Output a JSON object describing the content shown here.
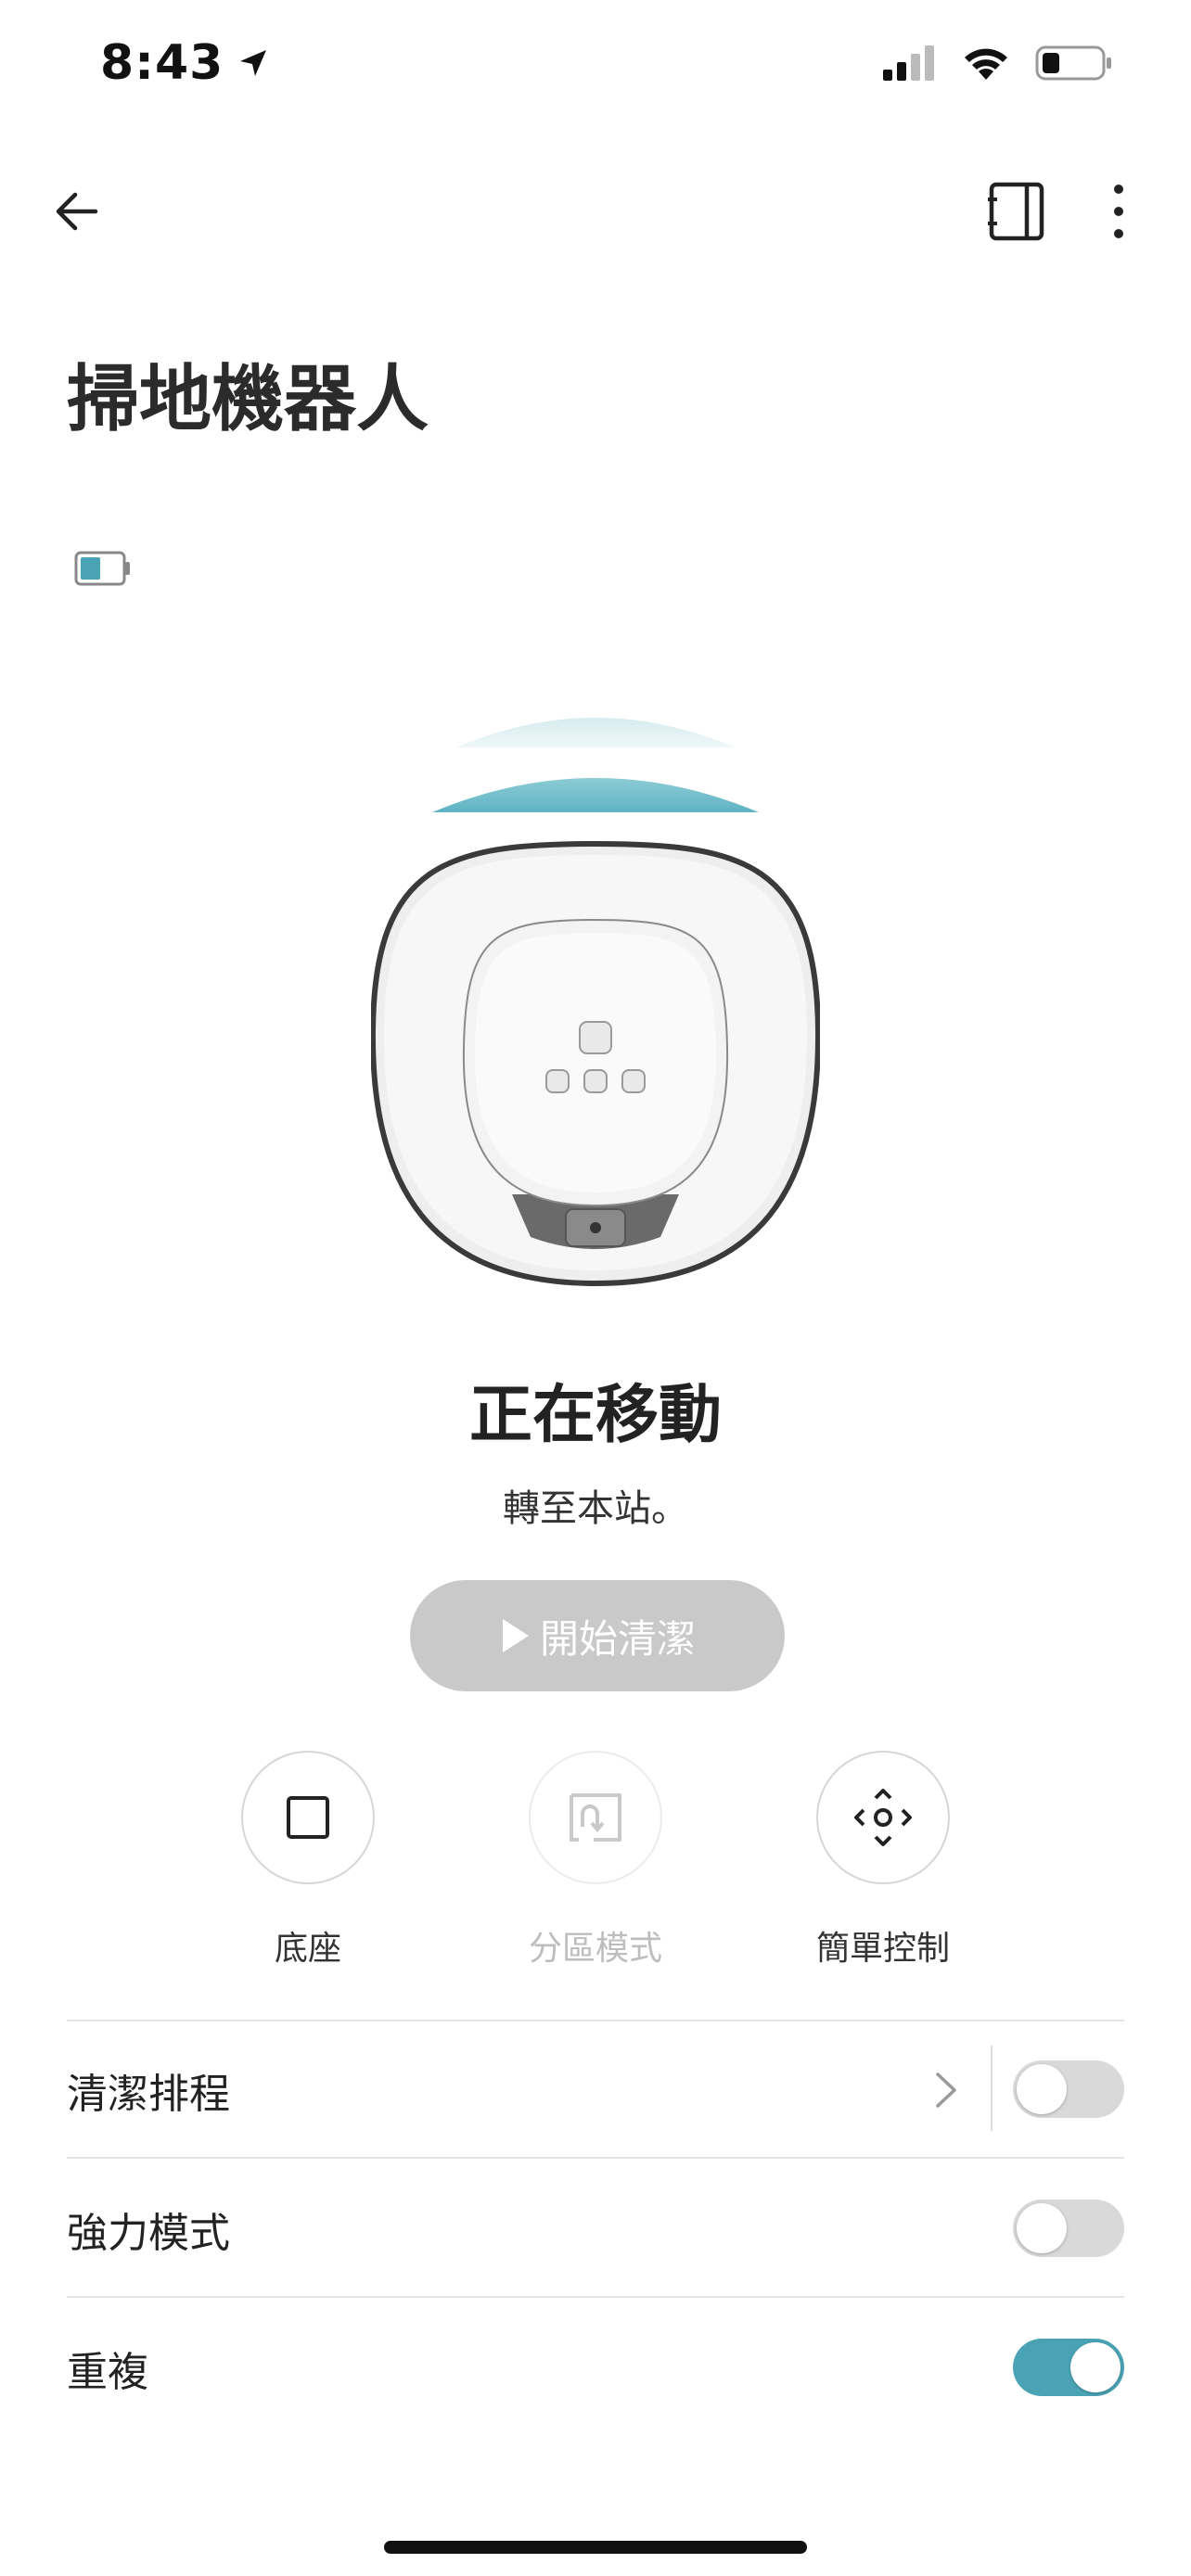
{
  "status_bar": {
    "time": "8:43"
  },
  "header": {
    "title": "掃地機器人"
  },
  "device": {
    "battery_level": 0.5
  },
  "state": {
    "title": "正在移動",
    "subtitle": "轉至本站。"
  },
  "start_button": {
    "label": "開始清潔"
  },
  "modes": [
    {
      "label": "底座",
      "icon": "square-stop-icon",
      "enabled": true
    },
    {
      "label": "分區模式",
      "icon": "zone-mode-icon",
      "enabled": false
    },
    {
      "label": "簡單控制",
      "icon": "direction-pad-icon",
      "enabled": true
    }
  ],
  "settings": [
    {
      "label": "清潔排程",
      "has_chevron": true,
      "toggle_on": false
    },
    {
      "label": "強力模式",
      "has_chevron": false,
      "toggle_on": false
    },
    {
      "label": "重複",
      "has_chevron": false,
      "toggle_on": true
    }
  ],
  "colors": {
    "accent": "#4aa3b5",
    "disabled_button": "#c9c9c9",
    "toggle_off": "#d9d9d9"
  }
}
